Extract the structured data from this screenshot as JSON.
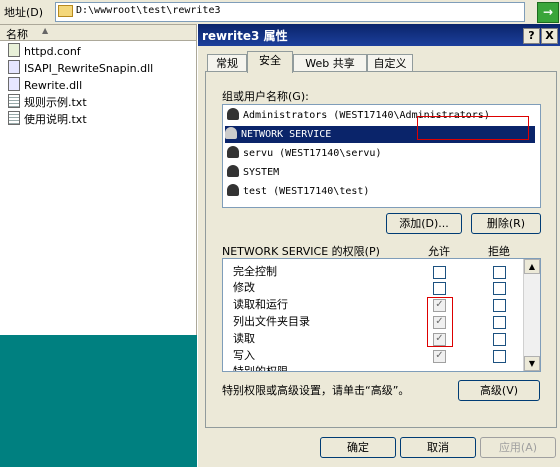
{
  "address_bar": {
    "label": "地址(D)",
    "path": "D:\\wwwroot\\test\\rewrite3",
    "go_icon": "go-arrow-icon"
  },
  "file_list": {
    "column_name": "名称",
    "files": [
      {
        "name": "httpd.conf",
        "icon": "conf-file-icon"
      },
      {
        "name": "ISAPI_RewriteSnapin.dll",
        "icon": "dll-file-icon"
      },
      {
        "name": "Rewrite.dll",
        "icon": "dll-file-icon"
      },
      {
        "name": "规则示例.txt",
        "icon": "text-file-icon"
      },
      {
        "name": "使用说明.txt",
        "icon": "text-file-icon"
      }
    ]
  },
  "dialog": {
    "title": "rewrite3 属性",
    "help_label": "?",
    "close_label": "X",
    "tabs": [
      {
        "label": "常规",
        "active": false
      },
      {
        "label": "安全",
        "active": true
      },
      {
        "label": "Web 共享",
        "active": false
      },
      {
        "label": "自定义",
        "active": false
      }
    ],
    "groups_label": "组或用户名称(G):",
    "users": [
      {
        "name": "Administrators (WEST17140\\Administrators)",
        "selected": false
      },
      {
        "name": "NETWORK SERVICE",
        "selected": true
      },
      {
        "name": "servu (WEST17140\\servu)",
        "selected": false
      },
      {
        "name": "SYSTEM",
        "selected": false
      },
      {
        "name": "test (WEST17140\\test)",
        "selected": false
      }
    ],
    "add_button": "添加(D)...",
    "remove_button": "删除(R)",
    "permissions_header": "NETWORK SERVICE 的权限(P)",
    "allow_header": "允许",
    "deny_header": "拒绝",
    "permissions": [
      {
        "name": "完全控制",
        "allow": false,
        "deny": false
      },
      {
        "name": "修改",
        "allow": false,
        "deny": false
      },
      {
        "name": "读取和运行",
        "allow": true,
        "deny": false
      },
      {
        "name": "列出文件夹目录",
        "allow": true,
        "deny": false
      },
      {
        "name": "读取",
        "allow": true,
        "deny": false
      },
      {
        "name": "写入",
        "allow": true,
        "deny": false
      },
      {
        "name": "特别的权限",
        "allow": false,
        "deny": false
      }
    ],
    "advanced_text": "特别权限或高级设置，请单击“高级”。",
    "advanced_button": "高级(V)",
    "ok_button": "确定",
    "cancel_button": "取消",
    "apply_button": "应用(A)"
  },
  "colors": {
    "selection": "#0a246a",
    "title_bar": "#0a246a",
    "highlight_box": "#dd0000",
    "desktop": "#008080"
  }
}
